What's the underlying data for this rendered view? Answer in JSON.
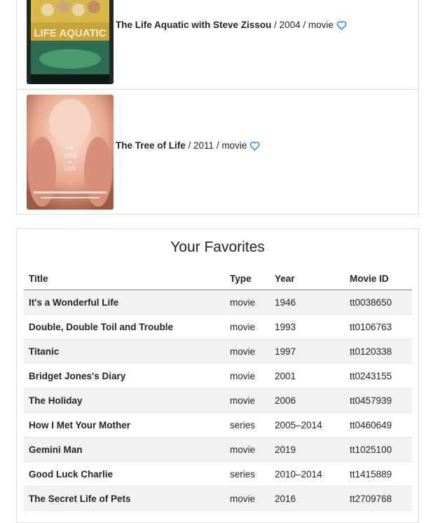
{
  "results": [
    {
      "title": "The Life Aquatic with Steve Zissou",
      "meta": " / 2004 / movie",
      "heart_icon": "heart-outline-icon"
    },
    {
      "title": "The Tree of Life",
      "meta": " / 2011 / movie",
      "heart_icon": "heart-outline-icon"
    }
  ],
  "favorites": {
    "heading": "Your Favorites",
    "columns": [
      "Title",
      "Type",
      "Year",
      "Movie ID"
    ],
    "rows": [
      [
        "It's a Wonderful Life",
        "movie",
        "1946",
        "tt0038650"
      ],
      [
        "Double, Double Toil and Trouble",
        "movie",
        "1993",
        "tt0106763"
      ],
      [
        "Titanic",
        "movie",
        "1997",
        "tt0120338"
      ],
      [
        "Bridget Jones's Diary",
        "movie",
        "2001",
        "tt0243155"
      ],
      [
        "The Holiday",
        "movie",
        "2006",
        "tt0457939"
      ],
      [
        "How I Met Your Mother",
        "series",
        "2005–2014",
        "tt0460649"
      ],
      [
        "Gemini Man",
        "movie",
        "2019",
        "tt1025100"
      ],
      [
        "Good Luck Charlie",
        "series",
        "2010–2014",
        "tt1415889"
      ],
      [
        "The Secret Life of Pets",
        "movie",
        "2016",
        "tt2709768"
      ]
    ]
  },
  "colors": {
    "accent": "#0d6efd",
    "row_stripe": "#f2f2f2",
    "border": "#dcdcdc"
  }
}
